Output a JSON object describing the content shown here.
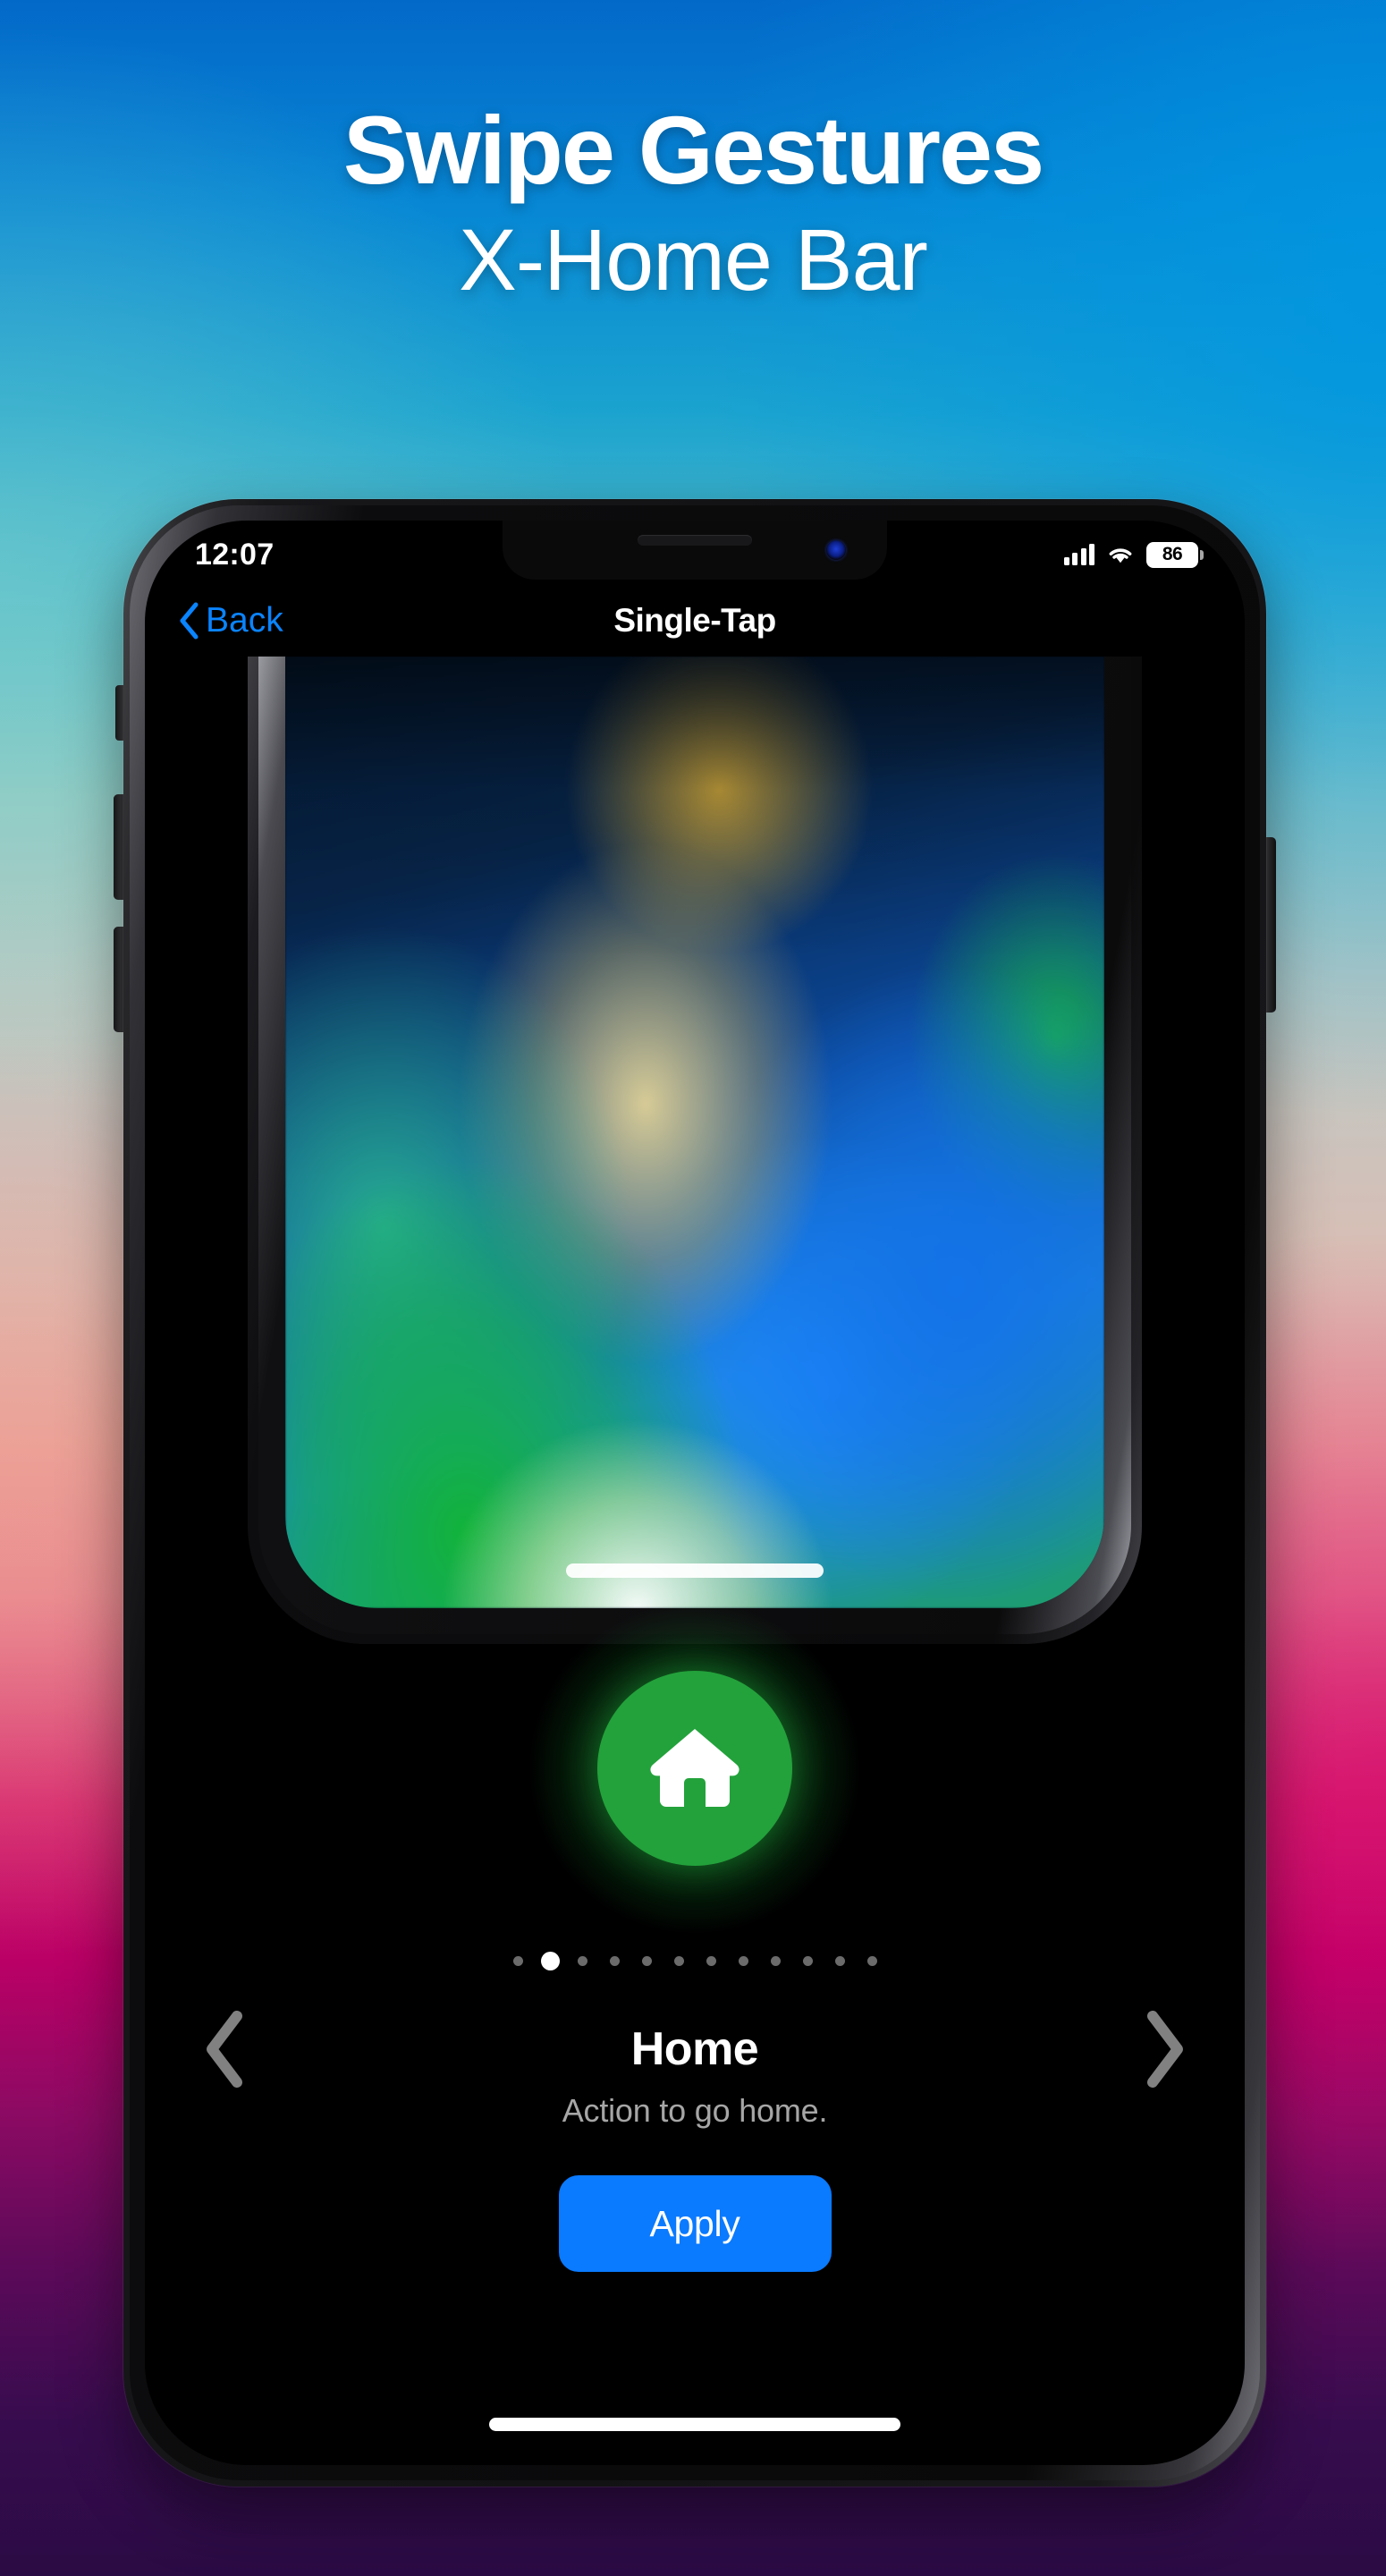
{
  "headline": {
    "line1": "Swipe Gestures",
    "line2": "X-Home Bar"
  },
  "phone": {
    "statusbar": {
      "time": "12:07",
      "signal_icon": "cellular-signal-icon",
      "wifi_icon": "wifi-icon",
      "battery_level": "86"
    },
    "navbar": {
      "back_label": "Back",
      "back_icon": "chevron-left-icon",
      "title": "Single-Tap"
    },
    "action": {
      "icon": "home-icon",
      "circle_color": "#23a23b"
    },
    "pager": {
      "total_dots": 12,
      "active_index": 1
    },
    "carousel": {
      "prev_icon": "chevron-left-icon",
      "next_icon": "chevron-right-icon",
      "title": "Home",
      "description": "Action to go home."
    },
    "apply": {
      "label": "Apply",
      "color": "#0a7aff"
    }
  }
}
